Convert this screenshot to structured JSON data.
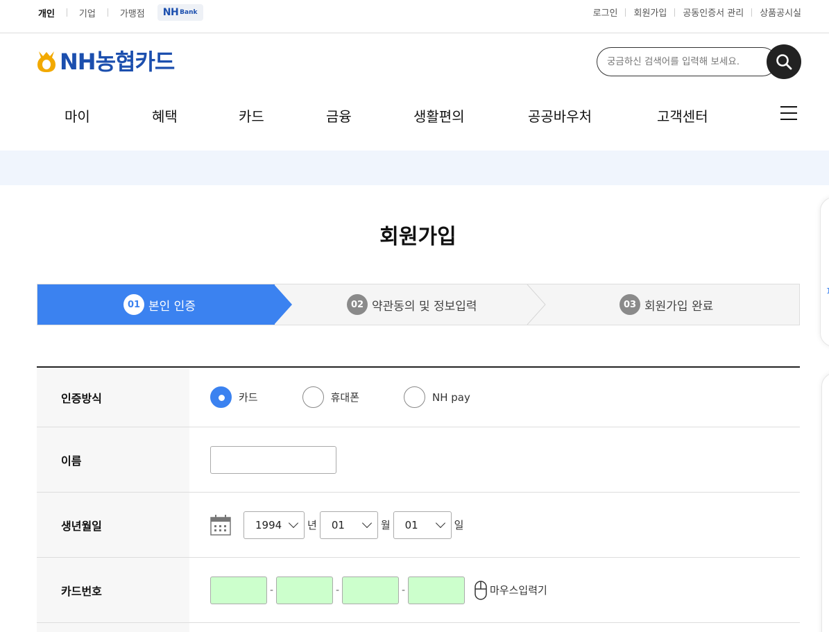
{
  "segments": [
    "개인",
    "기업",
    "가맹점"
  ],
  "nhbank": {
    "nh": "NH",
    "bank": "Bank"
  },
  "util_links": [
    "로그인",
    "회원가입",
    "공동인증서 관리",
    "상품공시실"
  ],
  "logo": {
    "text": "NH농협카드"
  },
  "search": {
    "placeholder": "궁금하신 검색어를 입력해 보세요."
  },
  "gnb": [
    "마이",
    "혜택",
    "카드",
    "금융",
    "생활편의",
    "공공바우처",
    "고객센터"
  ],
  "page_title": "회원가입",
  "steps": [
    {
      "num": "01",
      "label": "본인 인증"
    },
    {
      "num": "02",
      "label": "약관동의 및 정보입력"
    },
    {
      "num": "03",
      "label": "회원가입 완료"
    }
  ],
  "form": {
    "auth_label": "인증방식",
    "auth_options": [
      "카드",
      "휴대폰",
      "NH pay"
    ],
    "auth_selected": "카드",
    "name_label": "이름",
    "name_value": "",
    "birth_label": "생년월일",
    "birth": {
      "year": "1994",
      "year_unit": "년",
      "month": "01",
      "month_unit": "월",
      "day": "01",
      "day_unit": "일"
    },
    "card_label": "카드번호",
    "card_dash": "-",
    "mouse_input": "마우스입력기"
  },
  "colors": {
    "accent": "#3b82f0",
    "brand": "#1c4fae",
    "card_field": "#ccffcc"
  }
}
